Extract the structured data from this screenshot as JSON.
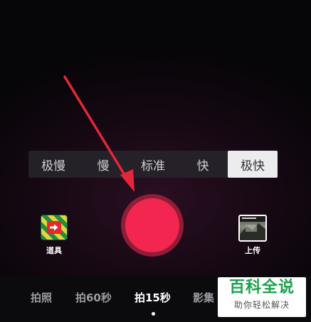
{
  "speed_bar": {
    "items": [
      {
        "label": "极慢"
      },
      {
        "label": "慢"
      },
      {
        "label": "标准"
      },
      {
        "label": "快"
      },
      {
        "label": "极快"
      }
    ],
    "selected": "极快"
  },
  "tools": {
    "props_label": "道具",
    "upload_label": "上传"
  },
  "modes": {
    "items": [
      {
        "label": "拍照"
      },
      {
        "label": "拍60秒"
      },
      {
        "label": "拍15秒"
      },
      {
        "label": "影集"
      }
    ],
    "selected": "拍15秒"
  },
  "watermark": {
    "title": "百科全说",
    "subtitle": "助你轻松解决"
  },
  "colors": {
    "record": "#f2264f",
    "record_ring": "#8f1d37",
    "annotation_arrow": "#e8253a",
    "watermark_green": "#1aa14a"
  }
}
